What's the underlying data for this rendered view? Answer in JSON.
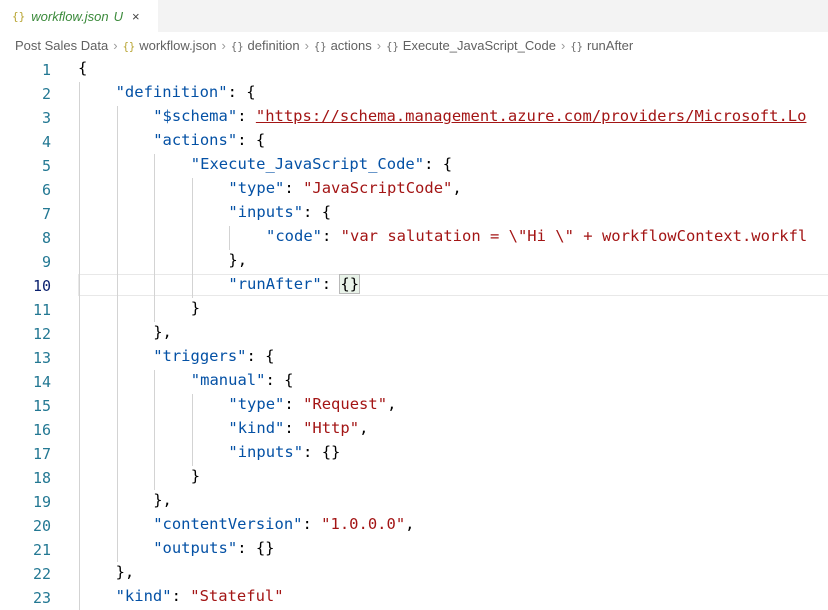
{
  "tab": {
    "icon": "json-braces-icon",
    "name": "workflow.json",
    "modified_marker": "U",
    "close_glyph": "×"
  },
  "breadcrumb": [
    {
      "label": "Post Sales Data",
      "icon": ""
    },
    {
      "label": "workflow.json",
      "icon": "{}"
    },
    {
      "label": "definition",
      "icon": "{}"
    },
    {
      "label": "actions",
      "icon": "{}"
    },
    {
      "label": "Execute_JavaScript_Code",
      "icon": "{}"
    },
    {
      "label": "runAfter",
      "icon": "{}"
    }
  ],
  "editor": {
    "active_line": 10,
    "colors": {
      "key": "#0451a5",
      "string": "#a31515",
      "line_number": "#237893",
      "active_line_number": "#0b216f"
    },
    "lines": [
      {
        "n": "1",
        "indent": 0,
        "tokens": [
          [
            "p",
            "{"
          ]
        ]
      },
      {
        "n": "2",
        "indent": 1,
        "tokens": [
          [
            "k",
            "\"definition\""
          ],
          [
            "p",
            ": {"
          ]
        ]
      },
      {
        "n": "3",
        "indent": 2,
        "tokens": [
          [
            "k",
            "\"$schema\""
          ],
          [
            "p",
            ": "
          ],
          [
            "u",
            "\"https://schema.management.azure.com/providers/Microsoft.Lo"
          ]
        ]
      },
      {
        "n": "4",
        "indent": 2,
        "tokens": [
          [
            "k",
            "\"actions\""
          ],
          [
            "p",
            ": {"
          ]
        ]
      },
      {
        "n": "5",
        "indent": 3,
        "tokens": [
          [
            "k",
            "\"Execute_JavaScript_Code\""
          ],
          [
            "p",
            ": {"
          ]
        ]
      },
      {
        "n": "6",
        "indent": 4,
        "tokens": [
          [
            "k",
            "\"type\""
          ],
          [
            "p",
            ": "
          ],
          [
            "s",
            "\"JavaScriptCode\""
          ],
          [
            "p",
            ","
          ]
        ]
      },
      {
        "n": "7",
        "indent": 4,
        "tokens": [
          [
            "k",
            "\"inputs\""
          ],
          [
            "p",
            ": {"
          ]
        ]
      },
      {
        "n": "8",
        "indent": 5,
        "tokens": [
          [
            "k",
            "\"code\""
          ],
          [
            "p",
            ": "
          ],
          [
            "s",
            "\"var salutation = \\\"Hi \\\" + workflowContext.workfl"
          ]
        ]
      },
      {
        "n": "9",
        "indent": 4,
        "tokens": [
          [
            "p",
            "},"
          ]
        ]
      },
      {
        "n": "10",
        "indent": 4,
        "tokens": [
          [
            "k",
            "\"runAfter\""
          ],
          [
            "p",
            ": "
          ],
          [
            "b",
            "{}"
          ]
        ]
      },
      {
        "n": "11",
        "indent": 3,
        "tokens": [
          [
            "p",
            "}"
          ]
        ]
      },
      {
        "n": "12",
        "indent": 2,
        "tokens": [
          [
            "p",
            "},"
          ]
        ]
      },
      {
        "n": "13",
        "indent": 2,
        "tokens": [
          [
            "k",
            "\"triggers\""
          ],
          [
            "p",
            ": {"
          ]
        ]
      },
      {
        "n": "14",
        "indent": 3,
        "tokens": [
          [
            "k",
            "\"manual\""
          ],
          [
            "p",
            ": {"
          ]
        ]
      },
      {
        "n": "15",
        "indent": 4,
        "tokens": [
          [
            "k",
            "\"type\""
          ],
          [
            "p",
            ": "
          ],
          [
            "s",
            "\"Request\""
          ],
          [
            "p",
            ","
          ]
        ]
      },
      {
        "n": "16",
        "indent": 4,
        "tokens": [
          [
            "k",
            "\"kind\""
          ],
          [
            "p",
            ": "
          ],
          [
            "s",
            "\"Http\""
          ],
          [
            "p",
            ","
          ]
        ]
      },
      {
        "n": "17",
        "indent": 4,
        "tokens": [
          [
            "k",
            "\"inputs\""
          ],
          [
            "p",
            ": {}"
          ]
        ]
      },
      {
        "n": "18",
        "indent": 3,
        "tokens": [
          [
            "p",
            "}"
          ]
        ]
      },
      {
        "n": "19",
        "indent": 2,
        "tokens": [
          [
            "p",
            "},"
          ]
        ]
      },
      {
        "n": "20",
        "indent": 2,
        "tokens": [
          [
            "k",
            "\"contentVersion\""
          ],
          [
            "p",
            ": "
          ],
          [
            "s",
            "\"1.0.0.0\""
          ],
          [
            "p",
            ","
          ]
        ]
      },
      {
        "n": "21",
        "indent": 2,
        "tokens": [
          [
            "k",
            "\"outputs\""
          ],
          [
            "p",
            ": {}"
          ]
        ]
      },
      {
        "n": "22",
        "indent": 1,
        "tokens": [
          [
            "p",
            "},"
          ]
        ]
      },
      {
        "n": "23",
        "indent": 1,
        "tokens": [
          [
            "k",
            "\"kind\""
          ],
          [
            "p",
            ": "
          ],
          [
            "s",
            "\"Stateful\""
          ]
        ]
      }
    ]
  }
}
